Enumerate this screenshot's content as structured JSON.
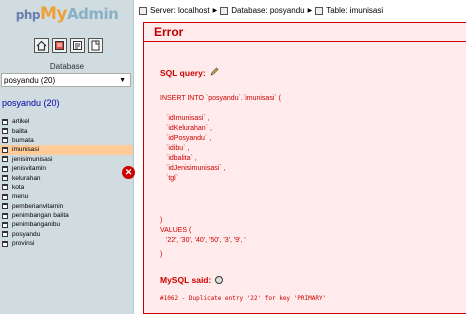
{
  "nav": {
    "logo": {
      "php": "php",
      "my": "My",
      "admin": "Admin"
    },
    "quick_icons": [
      "home-icon",
      "log-icon",
      "query-icon",
      "docs-icon"
    ],
    "database_label": "Database",
    "database_select": "posyandu (20)",
    "db_title": "posyandu (20)",
    "tables": [
      "artikel",
      "balita",
      "bumata",
      "imunisasi",
      "jenisimunisasi",
      "jenisvitamin",
      "kelurahan",
      "kota",
      "menu",
      "pemberianvitamin",
      "penimbangan balita",
      "penimbanganibu",
      "posyandu",
      "provinsi"
    ],
    "active_table_index": 3
  },
  "breadcrumb": {
    "server": "Server: localhost",
    "database": "Database: posyandu",
    "table": "Table: imunisasi"
  },
  "error": {
    "title": "Error",
    "sql_query_label": "SQL query:",
    "code_lines": [
      "INSERT INTO `posyandu`.`imunisasi` (",
      "`idImunisasi` ,",
      "`idKelurahan` ,",
      "`idPosyandu` ,",
      "`idibu` ,",
      "`idbalita` ,",
      "`idJenisimunisasi` ,",
      "`tgl`",
      ")",
      "VALUES (",
      "'22', '30', '40', '50', '3', '9', '",
      ")"
    ],
    "mysql_said_label": "MySQL said:",
    "message": "#1062 - Duplicate entry '22' for key 'PRIMARY'"
  },
  "colors": {
    "nav_bg": "#d0dce0",
    "active_row": "#ffcc99",
    "error_red": "#c00000",
    "error_bg": "#ffebeb"
  }
}
